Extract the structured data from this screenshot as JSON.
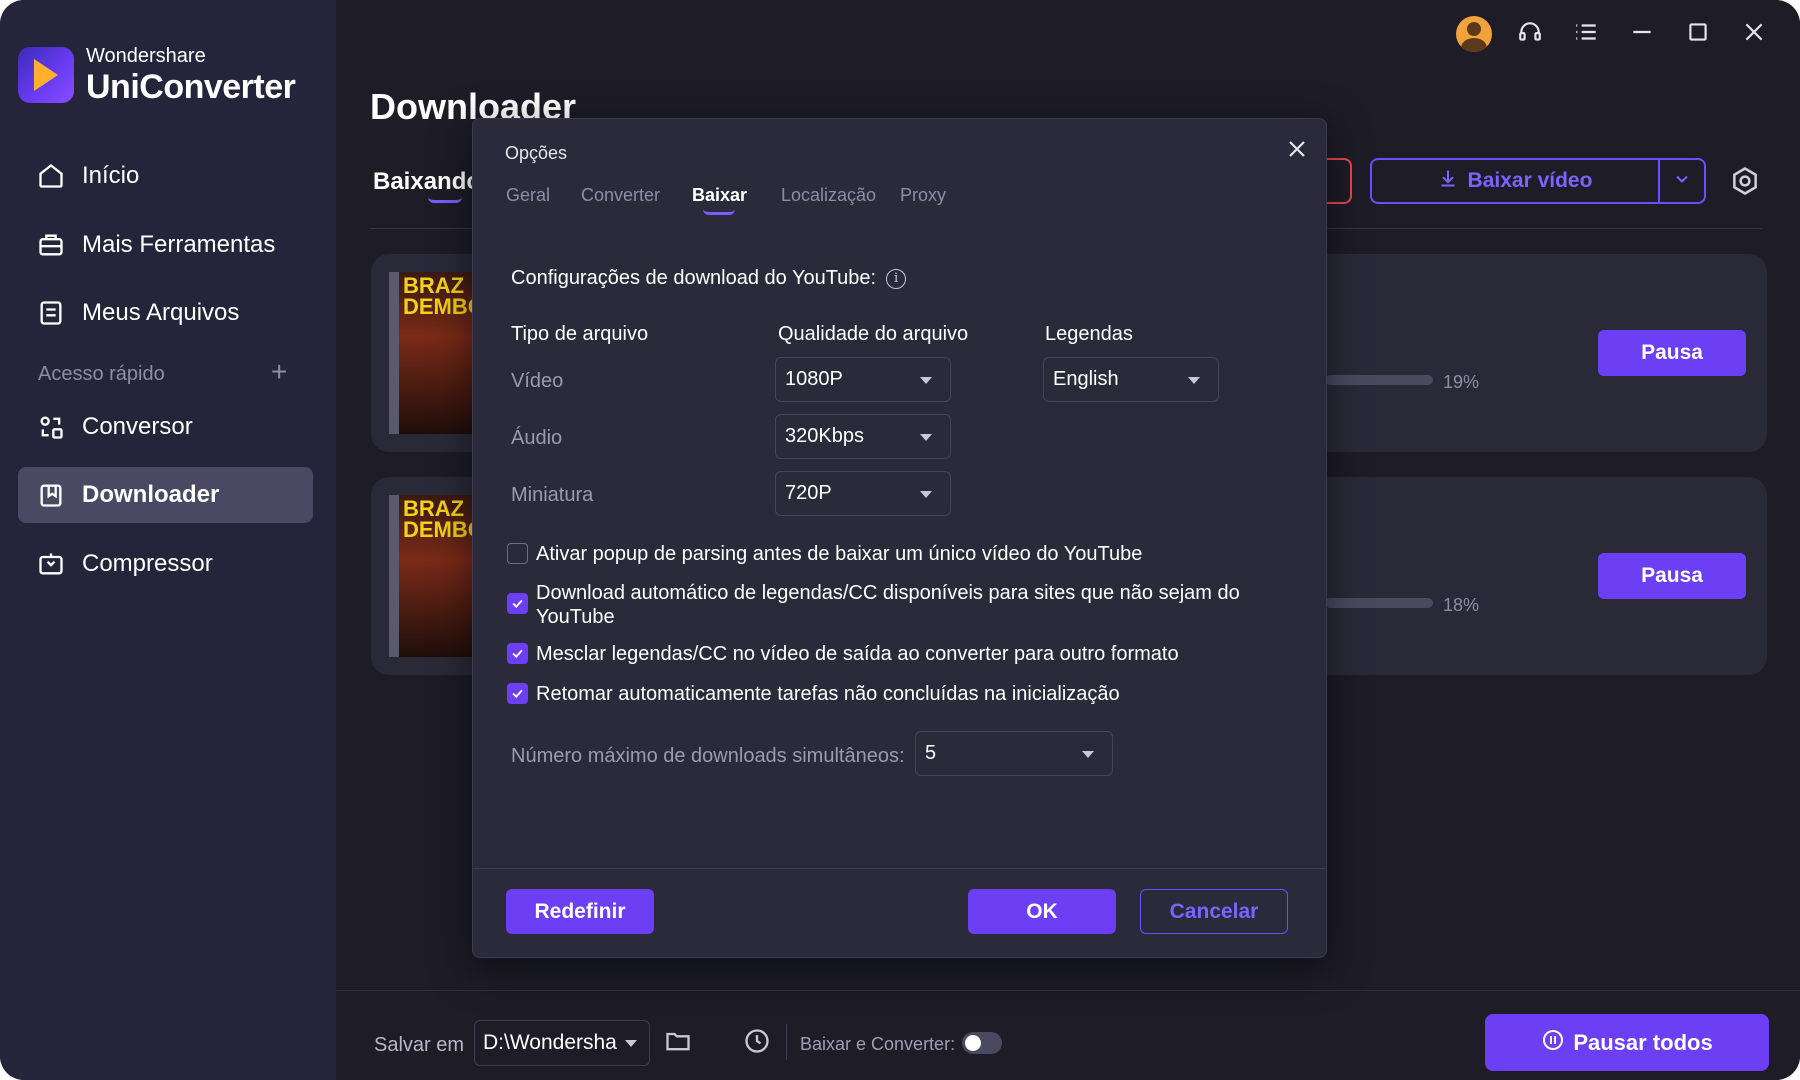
{
  "brand": {
    "company": "Wondershare",
    "product": "UniConverter"
  },
  "sidebar": {
    "items": [
      {
        "label": "Início",
        "icon": "home-icon"
      },
      {
        "label": "Mais Ferramentas",
        "icon": "toolbox-icon"
      },
      {
        "label": "Meus Arquivos",
        "icon": "files-icon"
      },
      {
        "label": "Conversor",
        "icon": "converter-icon"
      },
      {
        "label": "Downloader",
        "icon": "downloader-icon",
        "active": true
      },
      {
        "label": "Compressor",
        "icon": "compressor-icon"
      }
    ],
    "quick_access_label": "Acesso rápido",
    "quick_access_add": "+"
  },
  "main": {
    "title": "Downloader",
    "tab_downloading": "Baixando",
    "download_button_label": "Baixar vídeo",
    "downloads": [
      {
        "thumb_text": "BRAZ DEMBO",
        "progress": "19%",
        "progress_value": 0.19,
        "action": "Pausa"
      },
      {
        "thumb_text": "BRAZ DEMBO",
        "progress": "18%",
        "progress_value": 0.18,
        "action": "Pausa"
      }
    ]
  },
  "footer": {
    "save_label": "Salvar em",
    "save_path": "D:\\Wondersha",
    "convert_label": "Baixar e Converter:",
    "convert_toggle": false,
    "pause_all_label": "Pausar todos"
  },
  "dialog": {
    "title": "Opções",
    "tabs": [
      "Geral",
      "Converter",
      "Baixar",
      "Localização",
      "Proxy"
    ],
    "active_tab": "Baixar",
    "section_title": "Configurações de download do YouTube:",
    "columns": {
      "type": "Tipo de arquivo",
      "quality": "Qualidade do arquivo",
      "subtitles": "Legendas"
    },
    "rows": [
      {
        "label": "Vídeo",
        "quality": "1080P",
        "subtitle": "English"
      },
      {
        "label": "Áudio",
        "quality": "320Kbps"
      },
      {
        "label": "Miniatura",
        "quality": "720P"
      }
    ],
    "checkboxes": [
      {
        "label": "Ativar popup de parsing antes de baixar um único vídeo do YouTube",
        "checked": false
      },
      {
        "label": "Download automático de legendas/CC disponíveis para sites que não sejam do YouTube",
        "checked": true
      },
      {
        "label": "Mesclar legendas/CC no vídeo de saída ao converter para outro formato",
        "checked": true
      },
      {
        "label": "Retomar automaticamente tarefas não concluídas na inicialização",
        "checked": true
      }
    ],
    "max_downloads_label": "Número máximo de downloads simultâneos:",
    "max_downloads_value": "5",
    "buttons": {
      "reset": "Redefinir",
      "ok": "OK",
      "cancel": "Cancelar"
    }
  },
  "colors": {
    "accent": "#6c3ff5",
    "sidebar_bg": "#25243a",
    "main_bg": "#1d1c27",
    "dialog_bg": "#2b2a3b",
    "danger": "#e8454f"
  }
}
